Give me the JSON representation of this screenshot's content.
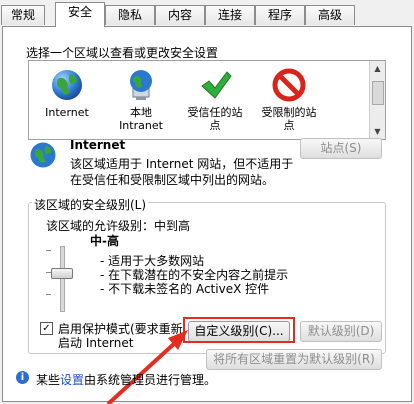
{
  "tabs": [
    "常规",
    "安全",
    "隐私",
    "内容",
    "连接",
    "程序",
    "高级"
  ],
  "active_tab": "安全",
  "zones_prompt": "选择一个区域以查看或更改安全设置",
  "zones": [
    {
      "label": "Internet",
      "icon": "globe-icon"
    },
    {
      "label": "本地\nIntranet",
      "icon": "intranet-globe-icon"
    },
    {
      "label": "受信任的站\n点",
      "icon": "green-check-icon"
    },
    {
      "label": "受限制的站\n点",
      "icon": "red-no-entry-icon"
    }
  ],
  "selected_zone": {
    "title": "Internet",
    "description_line1": "该区域适用于 Internet 网站，但不适用于",
    "description_line2": "在受信任和受限制区域中列出的网站。",
    "sites_button": "站点(S)"
  },
  "security_level": {
    "group_title": "该区域的安全级别(L)",
    "allowed_levels": "该区域的允许级别：中到高",
    "level_name": "中-高",
    "bullets": [
      "- 适用于大多数网站",
      "- 在下载潜在的不安全内容之前提示",
      "- 不下载未签名的 ActiveX 控件"
    ]
  },
  "protected_mode": {
    "checked": true,
    "label_line1": "启用保护模式(要求重新",
    "label_line2": "启动 Internet"
  },
  "buttons": {
    "custom_level": "自定义级别(C)...",
    "default_level": "默认级别(D)",
    "reset_all": "将所有区域重置为默认级别(R)"
  },
  "footer": {
    "prefix": "某些",
    "link": "设置",
    "suffix": "由系统管理员进行管理。"
  },
  "colors": {
    "highlight": "#e52c20",
    "link": "#1b4ec9"
  }
}
